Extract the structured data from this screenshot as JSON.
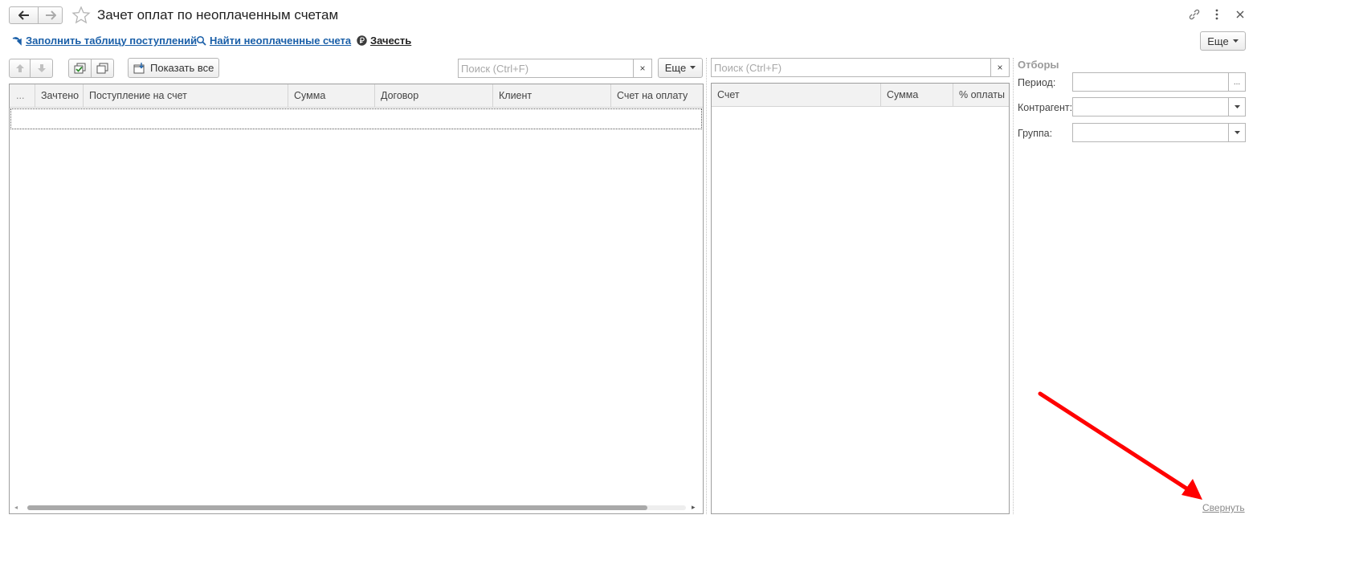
{
  "header": {
    "title": "Зачет оплат по неоплаченным счетам"
  },
  "commands": {
    "fill_table": "Заполнить таблицу поступлений",
    "find_unpaid": "Найти неоплаченные счета",
    "offset": "Зачесть",
    "more_top": "Еще"
  },
  "left_panel": {
    "show_all": "Показать все",
    "search_placeholder": "Поиск (Ctrl+F)",
    "clear": "×",
    "more": "Еще",
    "columns": [
      "...",
      "Зачтено",
      "Поступление на счет",
      "Сумма",
      "Договор",
      "Клиент",
      "Счет на оплату"
    ]
  },
  "right_panel": {
    "search_placeholder": "Поиск (Ctrl+F)",
    "clear": "×",
    "columns": [
      "Счет",
      "Сумма",
      "% оплаты"
    ]
  },
  "filters": {
    "title": "Отборы",
    "period_label": "Период:",
    "period_button": "...",
    "counterparty_label": "Контрагент:",
    "group_label": "Группа:",
    "collapse_link": "Свернуть"
  },
  "colors": {
    "link": "#1a5fa8",
    "arrow": "#ff0000"
  }
}
